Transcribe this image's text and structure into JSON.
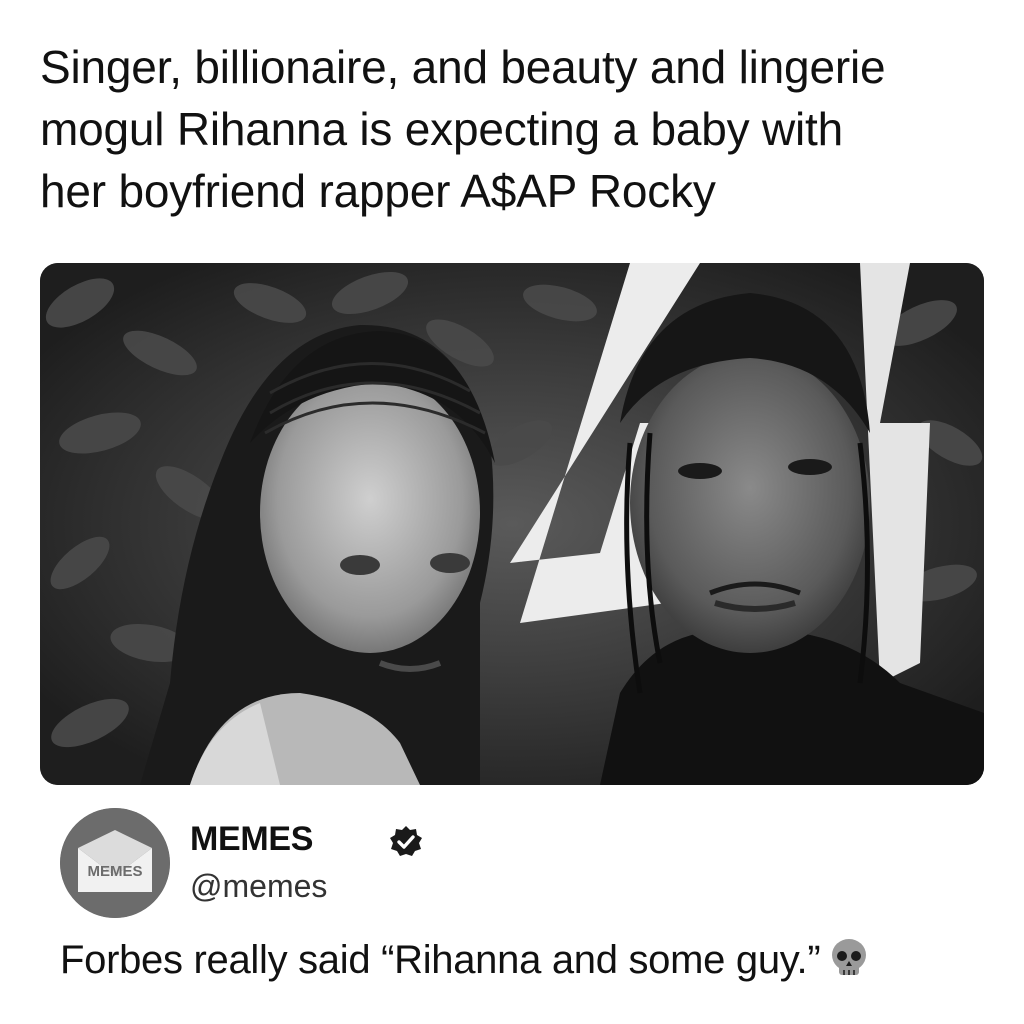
{
  "headline": {
    "line1": "Singer, billionaire, and beauty and lingerie",
    "line2": "mogul Rihanna is expecting a baby with",
    "line3": "her boyfriend rapper A$AP Rocky"
  },
  "photo": {
    "icon": "photo-of-couple",
    "style": "black-and-white"
  },
  "account": {
    "avatar_label": "MEMES",
    "display_name": "MEMES",
    "verified": true,
    "verified_icon": "verified-badge-icon",
    "handle": "@memes"
  },
  "tweet": {
    "text": "Forbes really said “Rihanna and some guy.”",
    "emoji": "skull-icon"
  },
  "colors": {
    "background": "#ffffff",
    "text": "#111111",
    "avatar_bg": "#6c6c6c"
  }
}
